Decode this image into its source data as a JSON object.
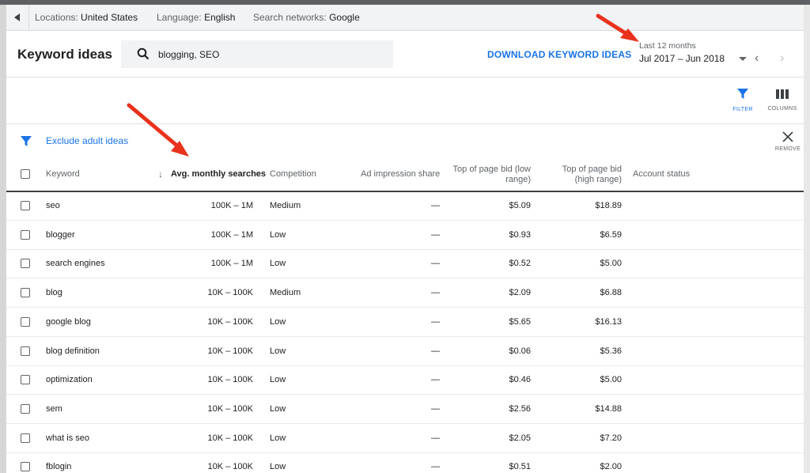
{
  "filter_bar": {
    "locations_label": "Locations:",
    "locations_value": "United States",
    "language_label": "Language:",
    "language_value": "English",
    "networks_label": "Search networks:",
    "networks_value": "Google"
  },
  "header": {
    "title": "Keyword ideas",
    "search_value": "blogging, SEO",
    "download_label": "DOWNLOAD KEYWORD IDEAS",
    "date_range_label": "Last 12 months",
    "date_range_value": "Jul 2017 – Jun 2018"
  },
  "toolbar": {
    "filter_label": "FILTER",
    "columns_label": "COLUMNS"
  },
  "exclude": {
    "text": "Exclude adult ideas",
    "remove_label": "REMOVE"
  },
  "colors": {
    "accent": "#1a73e8",
    "annotation_arrow": "#e8321c"
  },
  "table": {
    "headers": {
      "keyword": "Keyword",
      "avg_searches": "Avg. monthly searches",
      "competition": "Competition",
      "impression_share": "Ad impression share",
      "bid_low_1": "Top of page bid (low",
      "bid_low_2": "range)",
      "bid_high_1": "Top of page bid",
      "bid_high_2": "(high range)",
      "account_status": "Account status"
    },
    "rows": [
      {
        "keyword": "seo",
        "searches": "100K – 1M",
        "competition": "Medium",
        "share": "—",
        "low": "$5.09",
        "high": "$18.89"
      },
      {
        "keyword": "blogger",
        "searches": "100K – 1M",
        "competition": "Low",
        "share": "—",
        "low": "$0.93",
        "high": "$6.59"
      },
      {
        "keyword": "search engines",
        "searches": "100K – 1M",
        "competition": "Low",
        "share": "—",
        "low": "$0.52",
        "high": "$5.00"
      },
      {
        "keyword": "blog",
        "searches": "10K – 100K",
        "competition": "Medium",
        "share": "—",
        "low": "$2.09",
        "high": "$6.88"
      },
      {
        "keyword": "google blog",
        "searches": "10K – 100K",
        "competition": "Low",
        "share": "—",
        "low": "$5.65",
        "high": "$16.13"
      },
      {
        "keyword": "blog definition",
        "searches": "10K – 100K",
        "competition": "Low",
        "share": "—",
        "low": "$0.06",
        "high": "$5.36"
      },
      {
        "keyword": "optimization",
        "searches": "10K – 100K",
        "competition": "Low",
        "share": "—",
        "low": "$0.46",
        "high": "$5.00"
      },
      {
        "keyword": "sem",
        "searches": "10K – 100K",
        "competition": "Low",
        "share": "—",
        "low": "$2.56",
        "high": "$14.88"
      },
      {
        "keyword": "what is seo",
        "searches": "10K – 100K",
        "competition": "Low",
        "share": "—",
        "low": "$2.05",
        "high": "$7.20"
      },
      {
        "keyword": "fblogin",
        "searches": "10K – 100K",
        "competition": "Low",
        "share": "—",
        "low": "$0.51",
        "high": "$2.00"
      }
    ]
  }
}
